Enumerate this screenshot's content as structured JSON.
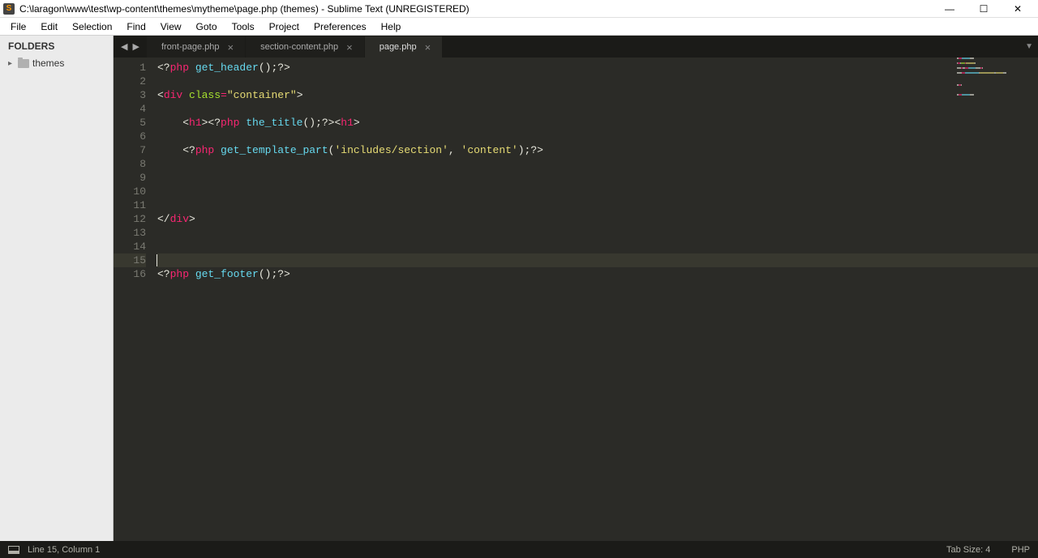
{
  "titlebar": {
    "icon_letter": "S",
    "path": "C:\\laragon\\www\\test\\wp-content\\themes\\mytheme\\page.php (themes) - Sublime Text (UNREGISTERED)"
  },
  "menu": [
    "File",
    "Edit",
    "Selection",
    "Find",
    "View",
    "Goto",
    "Tools",
    "Project",
    "Preferences",
    "Help"
  ],
  "sidebar": {
    "header": "FOLDERS",
    "items": [
      {
        "label": "themes"
      }
    ]
  },
  "tabs": [
    {
      "label": "front-page.php",
      "active": false
    },
    {
      "label": "section-content.php",
      "active": false
    },
    {
      "label": "page.php",
      "active": true
    }
  ],
  "nav_arrows": {
    "back": "◀",
    "forward": "▶"
  },
  "overflow_glyph": "▼",
  "close_glyph": "×",
  "gutter": {
    "start": 1,
    "end": 16,
    "active": 15
  },
  "code": {
    "lines": [
      {
        "n": 1,
        "segs": [
          {
            "t": "<?",
            "c": "punct"
          },
          {
            "t": "php ",
            "c": "kw"
          },
          {
            "t": "get_header",
            "c": "func"
          },
          {
            "t": "();",
            "c": "punct"
          },
          {
            "t": "?>",
            "c": "punct"
          }
        ]
      },
      {
        "n": 2,
        "segs": []
      },
      {
        "n": 3,
        "segs": [
          {
            "t": "<",
            "c": "punct"
          },
          {
            "t": "div",
            "c": "tag"
          },
          {
            "t": " ",
            "c": "punct"
          },
          {
            "t": "class",
            "c": "attr"
          },
          {
            "t": "=",
            "c": "op"
          },
          {
            "t": "\"container\"",
            "c": "str"
          },
          {
            "t": ">",
            "c": "punct"
          }
        ]
      },
      {
        "n": 4,
        "segs": []
      },
      {
        "n": 5,
        "segs": [
          {
            "t": "    <",
            "c": "punct"
          },
          {
            "t": "h1",
            "c": "tag"
          },
          {
            "t": "><?",
            "c": "punct"
          },
          {
            "t": "php ",
            "c": "kw"
          },
          {
            "t": "the_title",
            "c": "func"
          },
          {
            "t": "();",
            "c": "punct"
          },
          {
            "t": "?><",
            "c": "punct"
          },
          {
            "t": "h1",
            "c": "tag"
          },
          {
            "t": ">",
            "c": "punct"
          }
        ]
      },
      {
        "n": 6,
        "segs": []
      },
      {
        "n": 7,
        "segs": [
          {
            "t": "    <?",
            "c": "punct"
          },
          {
            "t": "php ",
            "c": "kw"
          },
          {
            "t": "get_template_part",
            "c": "func"
          },
          {
            "t": "(",
            "c": "punct"
          },
          {
            "t": "'includes/section'",
            "c": "str"
          },
          {
            "t": ", ",
            "c": "punct"
          },
          {
            "t": "'content'",
            "c": "str"
          },
          {
            "t": ");",
            "c": "punct"
          },
          {
            "t": "?>",
            "c": "punct"
          }
        ]
      },
      {
        "n": 8,
        "segs": []
      },
      {
        "n": 9,
        "segs": []
      },
      {
        "n": 10,
        "segs": []
      },
      {
        "n": 11,
        "segs": []
      },
      {
        "n": 12,
        "segs": [
          {
            "t": "</",
            "c": "punct"
          },
          {
            "t": "div",
            "c": "tag"
          },
          {
            "t": ">",
            "c": "punct"
          }
        ]
      },
      {
        "n": 13,
        "segs": []
      },
      {
        "n": 14,
        "segs": []
      },
      {
        "n": 15,
        "segs": [],
        "cursor": true,
        "active": true
      },
      {
        "n": 16,
        "segs": [
          {
            "t": "<?",
            "c": "punct"
          },
          {
            "t": "php ",
            "c": "kw"
          },
          {
            "t": "get_footer",
            "c": "func"
          },
          {
            "t": "();",
            "c": "punct"
          },
          {
            "t": "?>",
            "c": "punct"
          }
        ]
      }
    ]
  },
  "statusbar": {
    "position": "Line 15, Column 1",
    "tab_size": "Tab Size: 4",
    "syntax": "PHP"
  },
  "minimap_colors": {
    "punct": "#e6e6dc",
    "tag": "#f92672",
    "func": "#66d9ef",
    "kw": "#f92672",
    "attr": "#a6e22e",
    "str": "#e6db74",
    "op": "#f92672"
  }
}
